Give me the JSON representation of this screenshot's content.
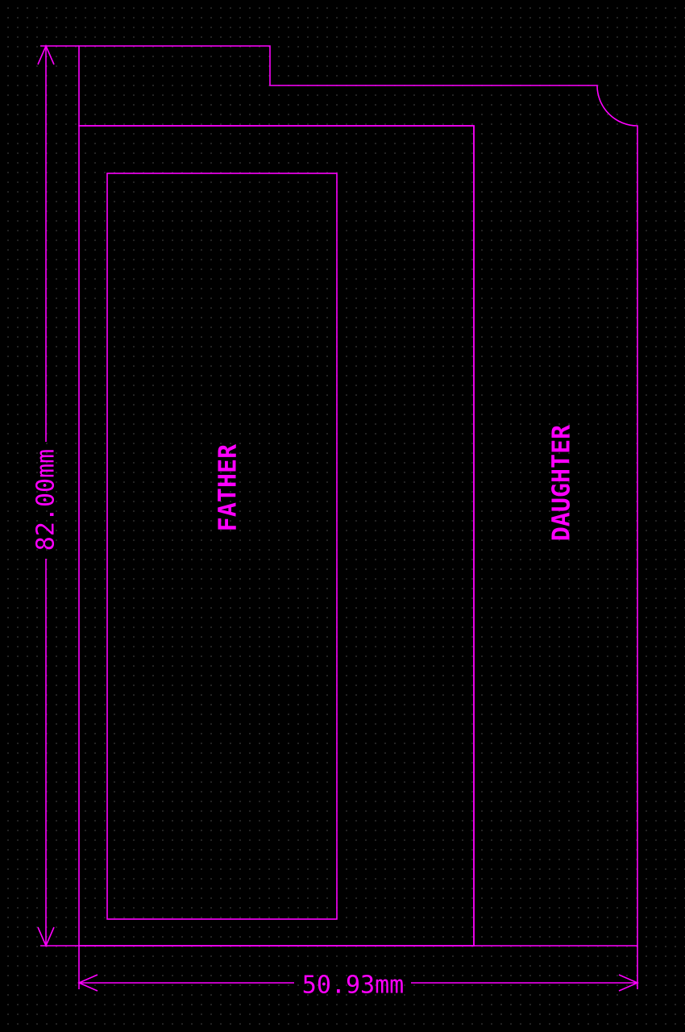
{
  "labels": {
    "father": "FATHER",
    "daughter": "DAUGHTER"
  },
  "dimensions": {
    "height": "82.00mm",
    "width": "50.93mm"
  },
  "colors": {
    "background": "#000000",
    "outline": "#ff00ff",
    "grid_dots": "#2a2a2a"
  }
}
